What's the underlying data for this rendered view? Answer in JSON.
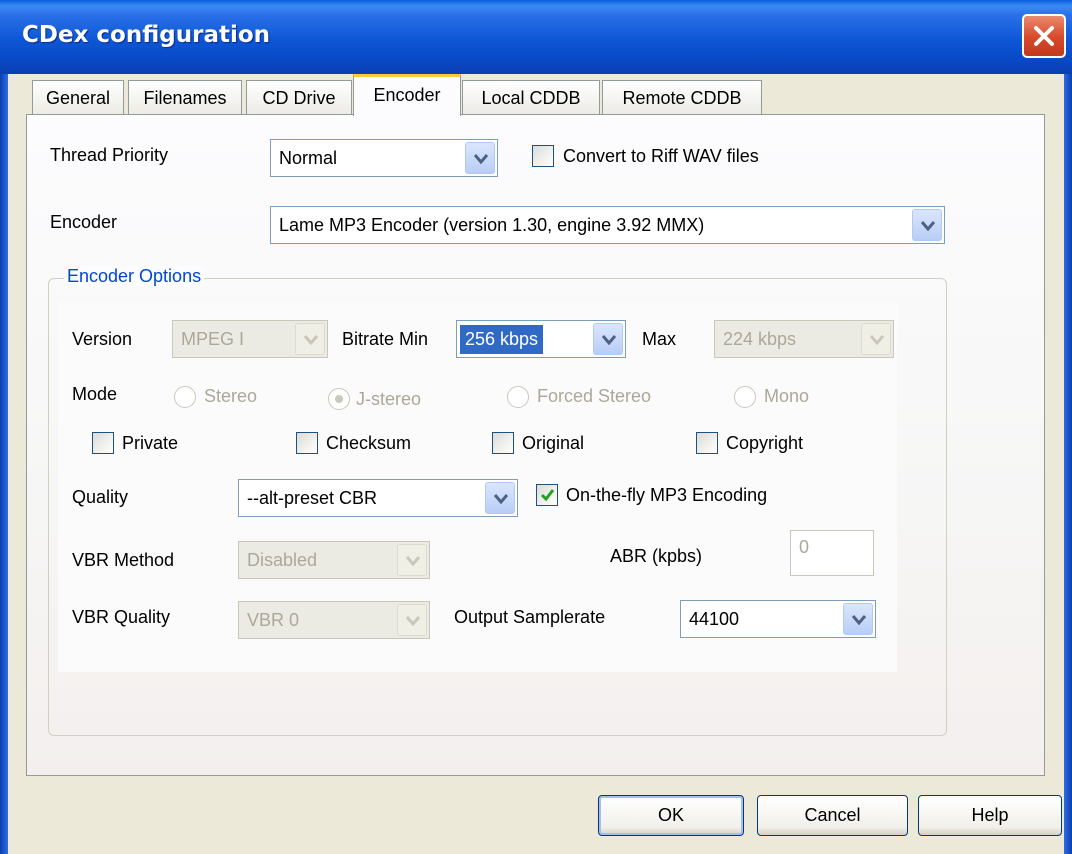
{
  "window": {
    "title": "CDex configuration",
    "close_label": "close-icon"
  },
  "tabs": [
    {
      "label": "General",
      "active": false
    },
    {
      "label": "Filenames",
      "active": false
    },
    {
      "label": "CD Drive",
      "active": false
    },
    {
      "label": "Encoder",
      "active": true
    },
    {
      "label": "Local CDDB",
      "active": false
    },
    {
      "label": "Remote CDDB",
      "active": false
    }
  ],
  "encoder_tab": {
    "thread_priority": {
      "label": "Thread Priority",
      "value": "Normal"
    },
    "convert_riff": {
      "label": "Convert to Riff WAV files",
      "checked": false
    },
    "encoder": {
      "label": "Encoder",
      "value": "Lame MP3 Encoder (version 1.30, engine 3.92 MMX)"
    },
    "options": {
      "title": "Encoder Options",
      "version": {
        "label": "Version",
        "value": "MPEG I"
      },
      "bitrate_min": {
        "label": "Bitrate Min",
        "value": "256 kbps"
      },
      "bitrate_max": {
        "label": "Max",
        "value": "224 kbps"
      },
      "mode": {
        "label": "Mode",
        "options": [
          "Stereo",
          "J-stereo",
          "Forced Stereo",
          "Mono"
        ],
        "selected": "J-stereo"
      },
      "flags": [
        {
          "label": "Private",
          "checked": false
        },
        {
          "label": "Checksum",
          "checked": false
        },
        {
          "label": "Original",
          "checked": false
        },
        {
          "label": "Copyright",
          "checked": false
        }
      ],
      "quality": {
        "label": "Quality",
        "value": "--alt-preset CBR"
      },
      "on_the_fly": {
        "label": "On-the-fly MP3 Encoding",
        "checked": true
      },
      "vbr_method": {
        "label": "VBR Method",
        "value": "Disabled"
      },
      "abr": {
        "label": "ABR (kpbs)",
        "value": "0"
      },
      "vbr_quality": {
        "label": "VBR Quality",
        "value": "VBR 0"
      },
      "output_samplerate": {
        "label": "Output Samplerate",
        "value": "44100"
      }
    }
  },
  "buttons": {
    "ok": "OK",
    "cancel": "Cancel",
    "help": "Help"
  },
  "colors": {
    "title_bar": "#0a56d6",
    "group_title": "#0046d5",
    "active_tab_accent": "#ffc83c",
    "selection": "#316ac5"
  }
}
